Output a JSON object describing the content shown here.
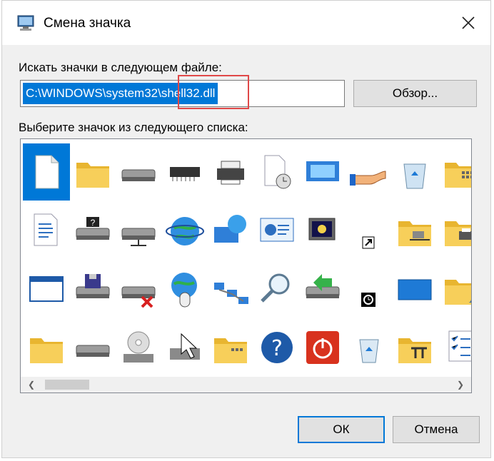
{
  "dialog": {
    "title": "Смена значка",
    "search_label": "Искать значки в следующем файле:",
    "path_value": "C:\\WINDOWS\\system32\\shell32.dll",
    "browse_label": "Обзор...",
    "list_label": "Выберите значок из следующего списка:",
    "ok_label": "ОК",
    "cancel_label": "Отмена"
  },
  "icons": [
    {
      "name": "blank-document-icon",
      "selected": true
    },
    {
      "name": "folder-icon"
    },
    {
      "name": "hard-drive-icon"
    },
    {
      "name": "memory-chip-icon"
    },
    {
      "name": "printer-icon"
    },
    {
      "name": "document-clock-icon"
    },
    {
      "name": "display-screen-icon"
    },
    {
      "name": "sharing-hand-icon"
    },
    {
      "name": "recycle-bin-full-icon"
    },
    {
      "name": "folder-grid-icon"
    },
    {
      "name": "text-document-icon"
    },
    {
      "name": "network-drive-help-icon"
    },
    {
      "name": "network-drive-icon"
    },
    {
      "name": "internet-globe-icon"
    },
    {
      "name": "globe-monitor-icon"
    },
    {
      "name": "control-panel-icon"
    },
    {
      "name": "monitor-moon-icon"
    },
    {
      "name": "shortcut-arrow-icon"
    },
    {
      "name": "network-folder-icon"
    },
    {
      "name": "printer-folder-icon"
    },
    {
      "name": "application-window-icon"
    },
    {
      "name": "floppy-drive-icon"
    },
    {
      "name": "disconnected-drive-icon"
    },
    {
      "name": "globe-mouse-icon"
    },
    {
      "name": "network-computers-icon"
    },
    {
      "name": "magnifier-icon"
    },
    {
      "name": "green-arrow-drive-icon"
    },
    {
      "name": "clock-badge-icon"
    },
    {
      "name": "blue-desktop-icon"
    },
    {
      "name": "fonts-folder-icon"
    },
    {
      "name": "folder-small-icon"
    },
    {
      "name": "drive-flat-icon"
    },
    {
      "name": "cd-drive-icon"
    },
    {
      "name": "pointer-desktop-icon"
    },
    {
      "name": "folder-grid-small-icon"
    },
    {
      "name": "help-question-icon"
    },
    {
      "name": "power-shutdown-icon"
    },
    {
      "name": "recycle-bin-icon"
    },
    {
      "name": "tools-folder-icon"
    },
    {
      "name": "checklist-icon"
    }
  ],
  "colors": {
    "accent": "#0078d7",
    "highlight": "#e04848",
    "folder": "#f2c94c"
  }
}
